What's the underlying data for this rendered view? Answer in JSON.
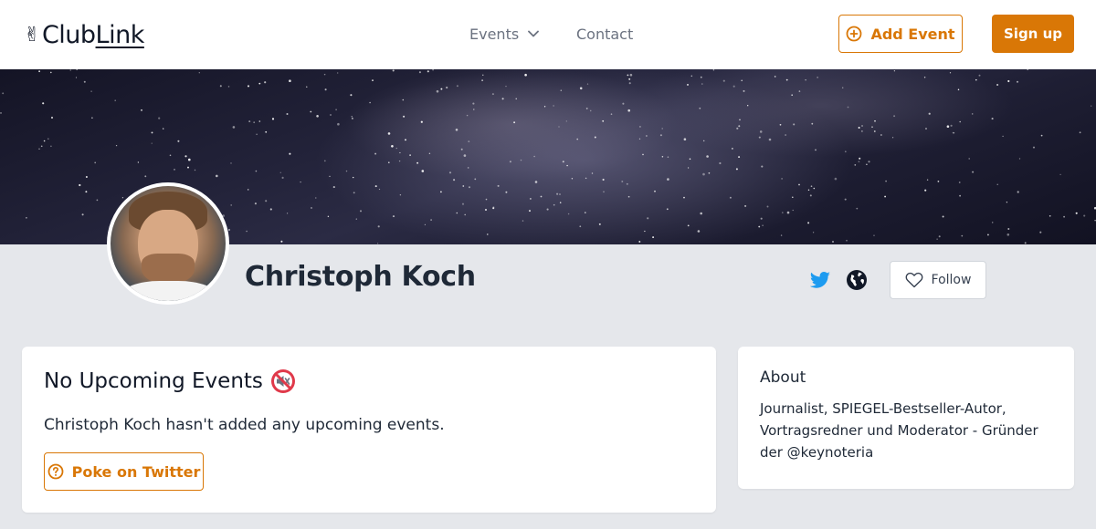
{
  "header": {
    "logo": {
      "icon": "victory-hand-icon",
      "text_part1": "Club",
      "text_part2": "Link"
    },
    "nav": {
      "events_label": "Events",
      "contact_label": "Contact"
    },
    "add_event_label": "Add Event",
    "sign_up_label": "Sign up"
  },
  "profile": {
    "name": "Christoph Koch",
    "links": [
      "twitter-icon",
      "globe-icon"
    ],
    "follow_label": "Follow"
  },
  "events_card": {
    "title": "No Upcoming Events",
    "title_icon": "muted-speaker-icon",
    "description": "Christoph Koch hasn't added any upcoming events.",
    "poke_label": "Poke on Twitter"
  },
  "about_card": {
    "heading": "About",
    "bio": "Journalist, SPIEGEL-Bestseller-Autor, Vortragsredner und Moderator - Gründer der @keynoteria"
  },
  "colors": {
    "accent": "#d97706",
    "twitter": "#1d9bf0",
    "page_bg": "#e5e7eb"
  }
}
